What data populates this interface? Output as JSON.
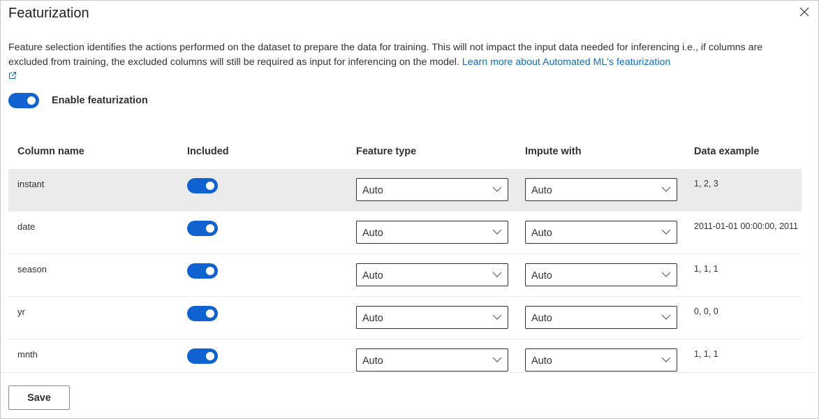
{
  "dialog": {
    "title": "Featurization",
    "close_icon": "close-icon",
    "description": "Feature selection identifies the actions performed on the dataset to prepare the data for training. This will not impact the input data needed for inferencing i.e., if columns are excluded from training, the excluded columns will still be required as input for inferencing on the model.",
    "learn_more_link": "Learn more about Automated ML's featurization",
    "external_link_icon": "external-link-icon",
    "enable_toggle": {
      "label": "Enable featurization",
      "on": true
    },
    "accent_color": "#0f62d0"
  },
  "table": {
    "headers": {
      "column_name": "Column name",
      "included": "Included",
      "feature_type": "Feature type",
      "impute_with": "Impute with",
      "data_example": "Data example"
    },
    "rows": [
      {
        "name": "instant",
        "included": true,
        "feature_type": "Auto",
        "impute_with": "Auto",
        "example": "1, 2, 3"
      },
      {
        "name": "date",
        "included": true,
        "feature_type": "Auto",
        "impute_with": "Auto",
        "example": "2011-01-01 00:00:00, 2011"
      },
      {
        "name": "season",
        "included": true,
        "feature_type": "Auto",
        "impute_with": "Auto",
        "example": "1, 1, 1"
      },
      {
        "name": "yr",
        "included": true,
        "feature_type": "Auto",
        "impute_with": "Auto",
        "example": "0, 0, 0"
      },
      {
        "name": "mnth",
        "included": true,
        "feature_type": "Auto",
        "impute_with": "Auto",
        "example": "1, 1, 1"
      }
    ]
  },
  "footer": {
    "save_label": "Save"
  }
}
